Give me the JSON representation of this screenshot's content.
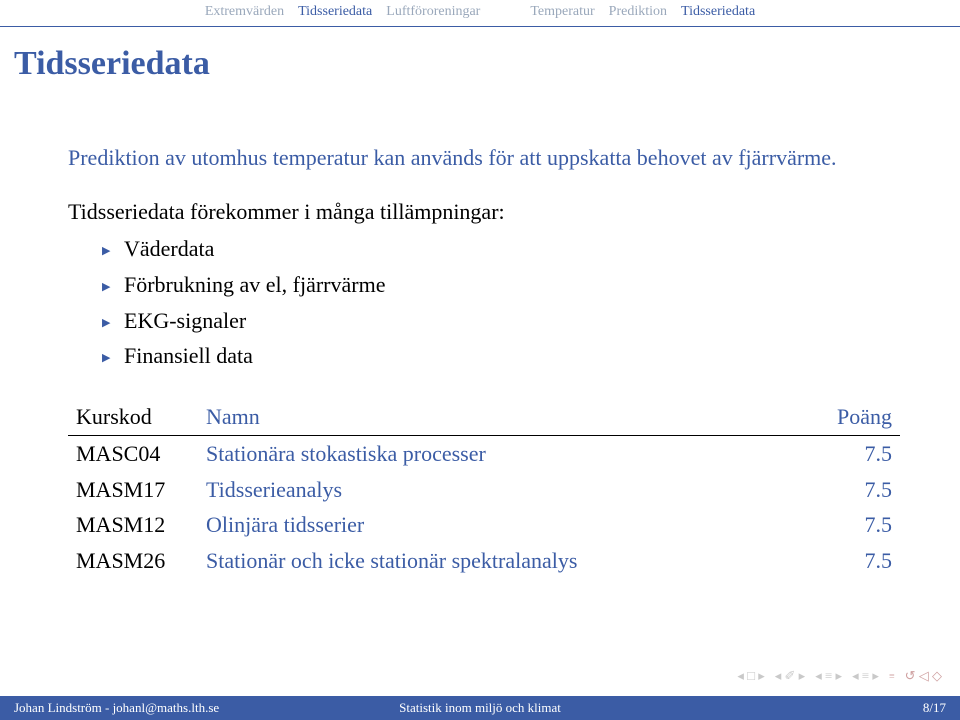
{
  "nav": {
    "left": [
      {
        "label": "Extremvärden",
        "active": false
      },
      {
        "label": "Tidsseriedata",
        "active": true
      },
      {
        "label": "Luftföroreningar",
        "active": false
      }
    ],
    "right": [
      {
        "label": "Temperatur",
        "active": false
      },
      {
        "label": "Prediktion",
        "active": false
      },
      {
        "label": "Tidsseriedata",
        "active": true
      }
    ]
  },
  "title": "Tidsseriedata",
  "intro": "Prediktion av utomhus temperatur kan används för att uppskatta behovet av fjärrvärme.",
  "apps_lead": "Tidsseriedata förekommer i många tillämpningar:",
  "bullets": [
    "Väderdata",
    "Förbrukning av el, fjärrvärme",
    "EKG-signaler",
    "Finansiell data"
  ],
  "table": {
    "headers": {
      "code": "Kurskod",
      "name": "Namn",
      "pts": "Poäng"
    },
    "rows": [
      {
        "code": "MASC04",
        "name": "Stationära stokastiska processer",
        "pts": "7.5"
      },
      {
        "code": "MASM17",
        "name": "Tidsserieanalys",
        "pts": "7.5"
      },
      {
        "code": "MASM12",
        "name": "Olinjära tidsserier",
        "pts": "7.5"
      },
      {
        "code": "MASM26",
        "name": "Stationär och icke stationär spektralanalys",
        "pts": "7.5"
      }
    ]
  },
  "footer": {
    "left": "Johan Lindström - johanl@maths.lth.se",
    "mid": "Statistik inom miljö och klimat",
    "right": "8/17"
  },
  "controls": {
    "first": "◂□▸",
    "prevsec": "◂✆▸",
    "prev": "◂≡▸",
    "next": "◂≡▸",
    "mode": "≡",
    "loop": "↻◁◇"
  }
}
